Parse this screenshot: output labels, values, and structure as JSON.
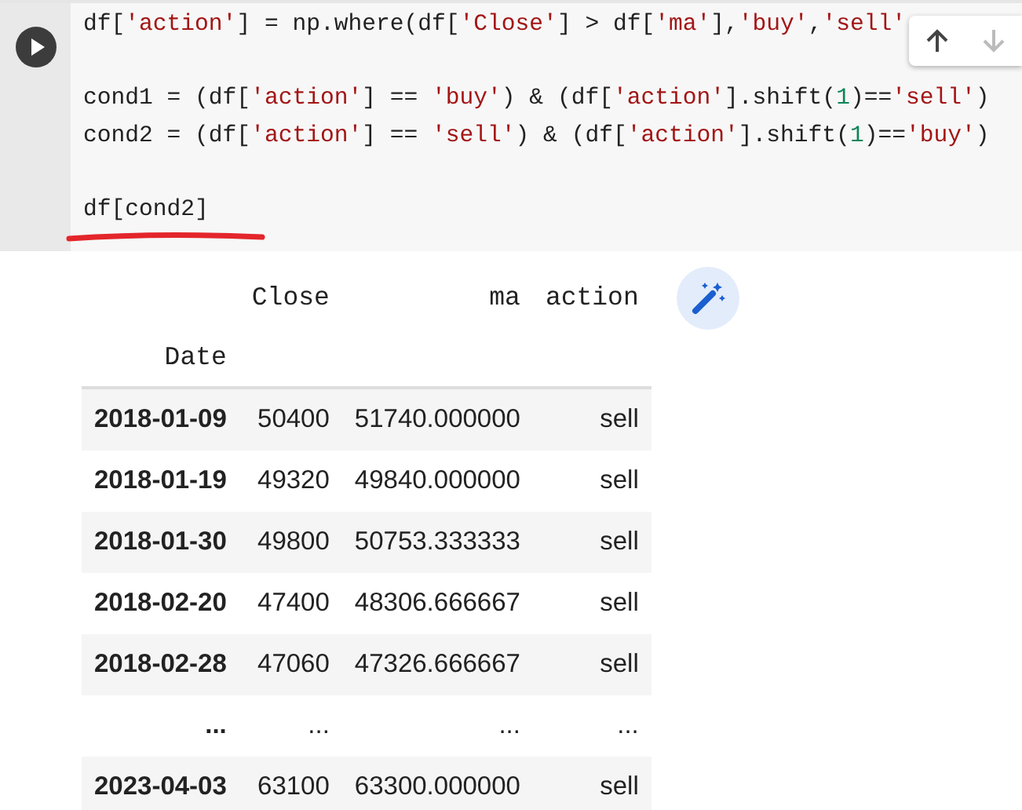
{
  "code": {
    "blocks": [
      [
        [
          {
            "kind": "plain",
            "text": "df["
          },
          {
            "kind": "string",
            "text": "'action'"
          },
          {
            "kind": "plain",
            "text": "] = np.where(df["
          },
          {
            "kind": "string",
            "text": "'Close'"
          },
          {
            "kind": "plain",
            "text": "] > df["
          },
          {
            "kind": "string",
            "text": "'ma'"
          },
          {
            "kind": "plain",
            "text": "],"
          },
          {
            "kind": "string",
            "text": "'buy'"
          },
          {
            "kind": "plain",
            "text": ","
          },
          {
            "kind": "string",
            "text": "'sell'"
          }
        ]
      ],
      [
        [
          {
            "kind": "plain",
            "text": "cond1 = (df["
          },
          {
            "kind": "string",
            "text": "'action'"
          },
          {
            "kind": "plain",
            "text": "] == "
          },
          {
            "kind": "string",
            "text": "'buy'"
          },
          {
            "kind": "plain",
            "text": ") & (df["
          },
          {
            "kind": "string",
            "text": "'action'"
          },
          {
            "kind": "plain",
            "text": "].shift("
          },
          {
            "kind": "number",
            "text": "1"
          },
          {
            "kind": "plain",
            "text": ")=="
          },
          {
            "kind": "string",
            "text": "'sell'"
          },
          {
            "kind": "plain",
            "text": ")"
          }
        ],
        [
          {
            "kind": "plain",
            "text": "cond2 = (df["
          },
          {
            "kind": "string",
            "text": "'action'"
          },
          {
            "kind": "plain",
            "text": "] == "
          },
          {
            "kind": "string",
            "text": "'sell'"
          },
          {
            "kind": "plain",
            "text": ") & (df["
          },
          {
            "kind": "string",
            "text": "'action'"
          },
          {
            "kind": "plain",
            "text": "].shift("
          },
          {
            "kind": "number",
            "text": "1"
          },
          {
            "kind": "plain",
            "text": ")=="
          },
          {
            "kind": "string",
            "text": "'buy'"
          },
          {
            "kind": "plain",
            "text": ")"
          }
        ]
      ],
      [
        [
          {
            "kind": "plain",
            "text": "df[cond2]"
          }
        ]
      ]
    ]
  },
  "toolbar": [
    {
      "kind": "up",
      "disabled": false
    },
    {
      "kind": "down",
      "disabled": true
    }
  ],
  "table": {
    "columns": [
      "Close",
      "ma",
      "action"
    ],
    "index_name": "Date",
    "rows": [
      {
        "index": "2018-01-09",
        "cells": [
          "50400",
          "51740.000000",
          "sell"
        ]
      },
      {
        "index": "2018-01-19",
        "cells": [
          "49320",
          "49840.000000",
          "sell"
        ]
      },
      {
        "index": "2018-01-30",
        "cells": [
          "49800",
          "50753.333333",
          "sell"
        ]
      },
      {
        "index": "2018-02-20",
        "cells": [
          "47400",
          "48306.666667",
          "sell"
        ]
      },
      {
        "index": "2018-02-28",
        "cells": [
          "47060",
          "47326.666667",
          "sell"
        ]
      },
      {
        "index": "...",
        "cells": [
          "...",
          "...",
          "..."
        ]
      },
      {
        "index": "2023-04-03",
        "cells": [
          "63100",
          "63300.000000",
          "sell"
        ]
      }
    ]
  }
}
